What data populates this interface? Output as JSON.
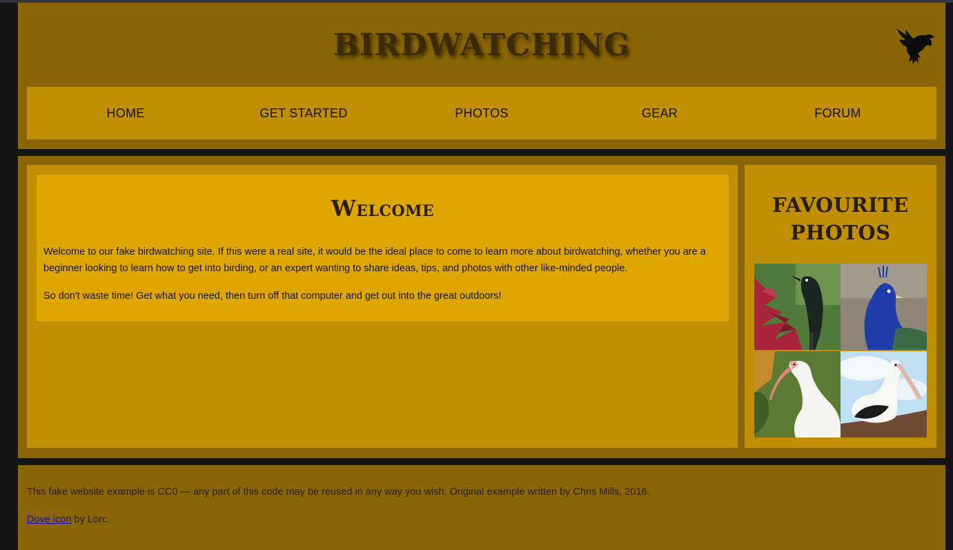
{
  "header": {
    "title": "BIRDWATCHING",
    "logo_icon": "dove-icon"
  },
  "nav": {
    "items": [
      {
        "label": "HOME"
      },
      {
        "label": "GET STARTED"
      },
      {
        "label": "PHOTOS"
      },
      {
        "label": "GEAR"
      },
      {
        "label": "FORUM"
      }
    ]
  },
  "main": {
    "heading": "Welcome",
    "paragraphs": [
      "Welcome to our fake birdwatching site. If this were a real site, it would be the ideal place to come to learn more about birdwatching, whether you are a beginner looking to learn how to get into birding, or an expert wanting to share ideas, tips, and photos with other like-minded people.",
      "So don't waste time! Get what you need, then turn off that computer and get out into the great outdoors!"
    ]
  },
  "sidebar": {
    "heading": "FAVOURITE PHOTOS",
    "photos": [
      "tui-photo",
      "peacock-photo",
      "ibis-photo",
      "pelican-photo"
    ]
  },
  "footer": {
    "license_text": "This fake website example is CC0 — any part of this code may be reused in any way you wish. Original example written by Chris Mills, 2016.",
    "credit_link": "Dove icon",
    "credit_suffix": " by Lorc."
  },
  "colors": {
    "band": "#8a6506",
    "panel": "#c18f03",
    "card": "#e0a600",
    "background": "#141414"
  }
}
